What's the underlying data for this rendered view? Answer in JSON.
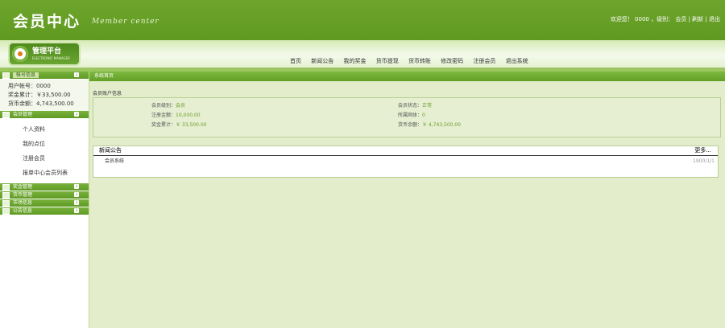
{
  "header": {
    "title_cn": "会员中心",
    "title_en": "Member center",
    "welcome": "欢迎您！",
    "user_id": "0000",
    "level_label": "，级别：",
    "level": "会员",
    "refresh": "刷新",
    "logout": "退出"
  },
  "badge": {
    "title": "管理平台",
    "subtitle": "ELECTRONIC MANAGER"
  },
  "nav": {
    "items": [
      "首页",
      "新闻公告",
      "我的奖金",
      "货币提现",
      "货币转账",
      "修改密码",
      "注册会员",
      "退出系统"
    ]
  },
  "sidebar": {
    "account_title": "帐号信息",
    "account_lines": [
      "用户帐号：0000",
      "奖金累计：￥33,500.00",
      "货币余额：4,743,500.00"
    ],
    "member_title": "会员管理",
    "member_items": [
      "个人资料",
      "我的点位",
      "注册会员",
      "报单中心会员列表"
    ],
    "groups": [
      "奖金管理",
      "货币管理",
      "市场信息",
      "公告信息"
    ],
    "toggle": "↓"
  },
  "main": {
    "bar_title": "系统首页",
    "section_title": "会员账户信息",
    "info_left": [
      {
        "label": "会员级别：",
        "value": "会员"
      },
      {
        "label": "注册金额：",
        "value": "10,000.00"
      },
      {
        "label": "奖金累计：",
        "value": "￥ 33,500.00"
      }
    ],
    "info_right": [
      {
        "label": "会员状态：",
        "value": "正常"
      },
      {
        "label": "所属网体：",
        "value": "0"
      },
      {
        "label": "货币余额：",
        "value": "￥ 4,743,500.00"
      }
    ],
    "news_title": "新闻公告",
    "news_more": "更多...",
    "news_items": [
      {
        "title": "会员系统",
        "date": "1900/1/1"
      }
    ]
  },
  "colors": {
    "header_green": "#5f9a20",
    "accent_green": "#6e9d2c",
    "bg": "#dfe9c6"
  }
}
